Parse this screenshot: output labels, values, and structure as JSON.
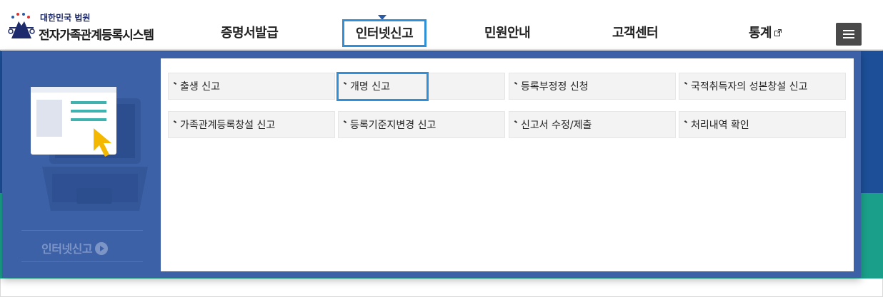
{
  "header": {
    "logo_org": "대한민국 법원",
    "logo_system": "전자가족관계등록시스템",
    "nav": [
      {
        "label": "증명서발급"
      },
      {
        "label": "인터넷신고",
        "active": true
      },
      {
        "label": "민원안내"
      },
      {
        "label": "고객센터"
      },
      {
        "label": "통계",
        "external": true
      }
    ],
    "menu_icon": "hamburger-icon"
  },
  "colors": {
    "primary_blue": "#1c4f98",
    "panel_blue": "#3d61a6",
    "teal": "#1aa08a",
    "highlight": "#2f8fd8"
  },
  "panel": {
    "section_title": "인터넷신고",
    "items": [
      {
        "label": "출생 신고"
      },
      {
        "label": "개명 신고",
        "selected": true
      },
      {
        "label": "등록부정정 신청"
      },
      {
        "label": "국적취득자의 성본창설 신고"
      },
      {
        "label": "가족관계등록창설 신고"
      },
      {
        "label": "등록기준지변경 신고"
      },
      {
        "label": "신고서 수정/제출"
      },
      {
        "label": "처리내역 확인"
      }
    ]
  }
}
